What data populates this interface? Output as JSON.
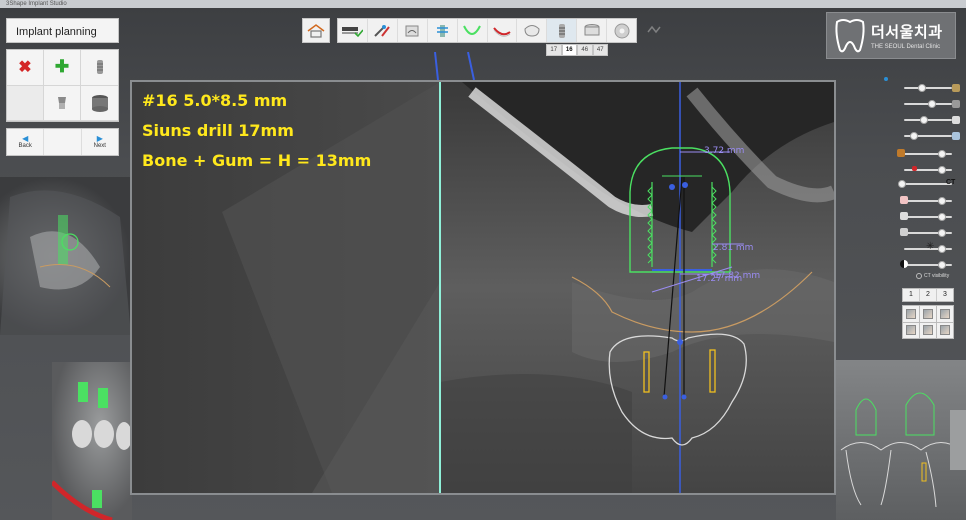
{
  "window": {
    "title": "3Shape Implant Studio"
  },
  "left_panel": {
    "title": "Implant planning",
    "tools": [
      {
        "name": "delete",
        "icon": "red-x-icon"
      },
      {
        "name": "add",
        "icon": "green-plus-icon"
      },
      {
        "name": "implant",
        "icon": "implant-screw-icon"
      },
      {
        "name": "empty",
        "icon": ""
      },
      {
        "name": "abutment",
        "icon": "abutment-icon"
      },
      {
        "name": "sleeve",
        "icon": "sleeve-icon"
      }
    ],
    "nav": {
      "back_label": "Back",
      "next_label": "Next"
    }
  },
  "toolbar": {
    "steps": [
      "scan-icon",
      "tools-icon",
      "panoramic-icon",
      "implant-add-icon",
      "arch-curve-icon",
      "nerve-icon",
      "crown-icon",
      "implant-icon",
      "sleeve-icon",
      "disc-icon"
    ],
    "active_step": 7
  },
  "tooth_tabs": [
    "17",
    "16",
    "46",
    "47"
  ],
  "selected_tooth": "16",
  "logo": {
    "korean": "더서울치과",
    "english": "THE SEOUL Dental Clinic"
  },
  "viewport": {
    "annotations": [
      "#16 5.0*8.5 mm",
      "Siuns drill 17mm",
      "Bone + Gum = H = 13mm"
    ],
    "measurements": {
      "top": "3.72 mm",
      "mid": "2.81 mm",
      "bottom_a": "17.27 mm",
      "bottom_b": "17.82 mm"
    }
  },
  "right_panel": {
    "ct_visibility_label": "CT visibility",
    "ct_label": "CT",
    "layout_tabs": [
      "1",
      "2",
      "3"
    ]
  },
  "colors": {
    "annotation_text": "#ffe81c",
    "implant_outline": "#4be062",
    "measurement": "#9a8cf2",
    "axis_line": "#3a5fe0",
    "cut_line": "#8ff0d8",
    "crown_outline": "#d9d9d9",
    "nerve_curve": "#c99b62"
  }
}
